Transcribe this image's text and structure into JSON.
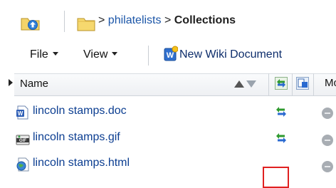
{
  "breadcrumb": {
    "separator_1": ">",
    "link": "philatelists",
    "separator_2": ">",
    "current": "Collections"
  },
  "toolbar": {
    "menus": [
      {
        "label": "File"
      },
      {
        "label": "View"
      }
    ],
    "new_wiki_label": "New Wiki Document"
  },
  "grid": {
    "header": {
      "name_label": "Name",
      "truncated_column": "Mo"
    },
    "rows": [
      {
        "name": "lincoln stamps.doc",
        "type_icon": "word-doc-icon",
        "sync_icon": "sync-icon"
      },
      {
        "name": "lincoln stamps.gif",
        "type_icon": "gif-icon",
        "sync_icon": "sync-icon"
      },
      {
        "name": "lincoln stamps.html",
        "type_icon": "html-icon",
        "sync_icon": ""
      }
    ]
  },
  "colors": {
    "link": "#1c56a8",
    "file_link": "#0c3e91",
    "highlight_box": "#e02020",
    "sync_green": "#2e9a2e",
    "sync_blue": "#2a6ad0"
  }
}
